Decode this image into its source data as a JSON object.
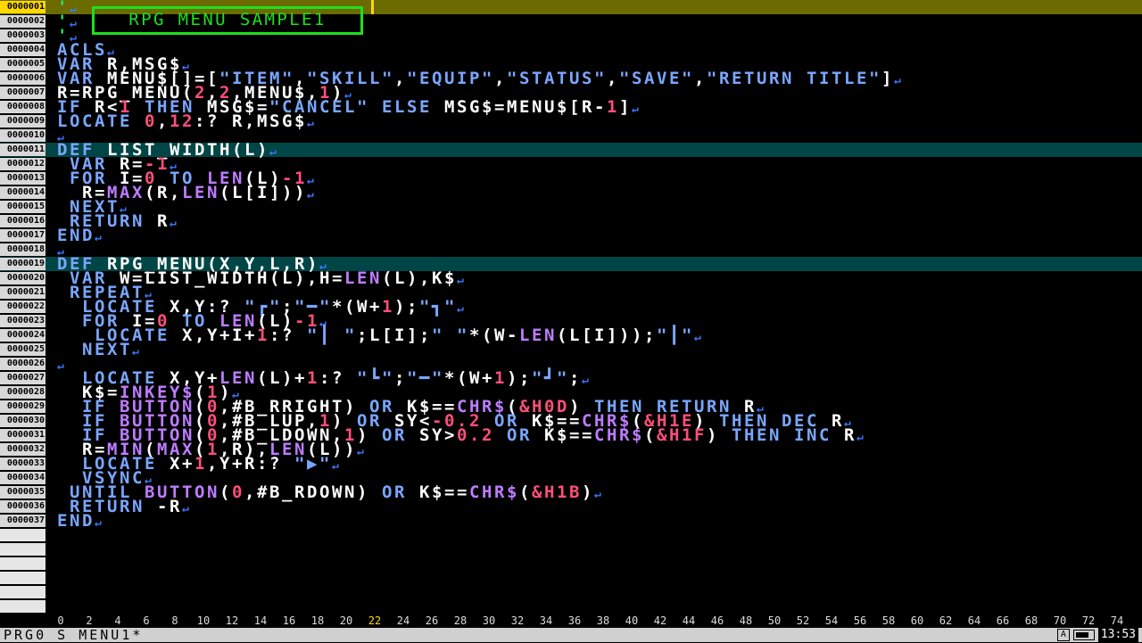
{
  "editor": {
    "current_line": 1,
    "box_comment": "RPG MENU SAMPLE1",
    "lines": [
      {
        "n": "0000001",
        "t": [
          [
            "'",
            "c"
          ]
        ]
      },
      {
        "n": "0000002",
        "t": [
          [
            "'",
            "c"
          ]
        ]
      },
      {
        "n": "0000003",
        "t": [
          [
            "'",
            "c"
          ]
        ]
      },
      {
        "n": "0000004",
        "t": [
          [
            "ACLS",
            "k"
          ]
        ]
      },
      {
        "n": "0000005",
        "t": [
          [
            "VAR",
            "k"
          ],
          [
            " R,MSG$",
            "w"
          ]
        ]
      },
      {
        "n": "0000006",
        "t": [
          [
            "VAR",
            "k"
          ],
          [
            " MENU$[]=[",
            "w"
          ],
          [
            "\"ITEM\"",
            "s"
          ],
          [
            ",",
            "w"
          ],
          [
            "\"SKILL\"",
            "s"
          ],
          [
            ",",
            "w"
          ],
          [
            "\"EQUIP\"",
            "s"
          ],
          [
            ",",
            "w"
          ],
          [
            "\"STATUS\"",
            "s"
          ],
          [
            ",",
            "w"
          ],
          [
            "\"SAVE\"",
            "s"
          ],
          [
            ",",
            "w"
          ],
          [
            "\"RETURN TITLE\"",
            "s"
          ],
          [
            "]",
            "w"
          ]
        ]
      },
      {
        "n": "0000007",
        "t": [
          [
            "R=RPG_MENU(",
            "w"
          ],
          [
            "2",
            "n"
          ],
          [
            ",",
            "w"
          ],
          [
            "2",
            "n"
          ],
          [
            ",MENU$,",
            "w"
          ],
          [
            "1",
            "n"
          ],
          [
            ")",
            "w"
          ]
        ]
      },
      {
        "n": "0000008",
        "t": [
          [
            "IF",
            "k"
          ],
          [
            " R<",
            "w"
          ],
          [
            "1",
            "n"
          ],
          [
            " ",
            "w"
          ],
          [
            "THEN",
            "k"
          ],
          [
            " MSG$=",
            "w"
          ],
          [
            "\"CANCEL\"",
            "s"
          ],
          [
            " ",
            "w"
          ],
          [
            "ELSE",
            "k"
          ],
          [
            " MSG$=MENU$[R-",
            "w"
          ],
          [
            "1",
            "n"
          ],
          [
            "]",
            "w"
          ]
        ]
      },
      {
        "n": "0000009",
        "t": [
          [
            "LOCATE",
            "k"
          ],
          [
            " ",
            "w"
          ],
          [
            "0",
            "n"
          ],
          [
            ",",
            "w"
          ],
          [
            "12",
            "n"
          ],
          [
            ":? R,MSG$",
            "w"
          ]
        ]
      },
      {
        "n": "0000010",
        "t": []
      },
      {
        "n": "0000011",
        "t": [
          [
            "DEF",
            "k"
          ],
          [
            " LIST_WIDTH(L)",
            "w"
          ]
        ],
        "hl": true
      },
      {
        "n": "0000012",
        "t": [
          [
            " ",
            "w"
          ],
          [
            "VAR",
            "k"
          ],
          [
            " R=",
            "w"
          ],
          [
            "-1",
            "n"
          ]
        ]
      },
      {
        "n": "0000013",
        "t": [
          [
            " ",
            "w"
          ],
          [
            "FOR",
            "k"
          ],
          [
            " I=",
            "w"
          ],
          [
            "0",
            "n"
          ],
          [
            " ",
            "w"
          ],
          [
            "TO",
            "k"
          ],
          [
            " ",
            "w"
          ],
          [
            "LEN",
            "f"
          ],
          [
            "(L)",
            "w"
          ],
          [
            "-1",
            "n"
          ]
        ]
      },
      {
        "n": "0000014",
        "t": [
          [
            "  R=",
            "w"
          ],
          [
            "MAX",
            "f"
          ],
          [
            "(R,",
            "w"
          ],
          [
            "LEN",
            "f"
          ],
          [
            "(L[I]))",
            "w"
          ]
        ]
      },
      {
        "n": "0000015",
        "t": [
          [
            " ",
            "w"
          ],
          [
            "NEXT",
            "k"
          ]
        ]
      },
      {
        "n": "0000016",
        "t": [
          [
            " ",
            "w"
          ],
          [
            "RETURN",
            "k"
          ],
          [
            " R",
            "w"
          ]
        ]
      },
      {
        "n": "0000017",
        "t": [
          [
            "END",
            "k"
          ]
        ]
      },
      {
        "n": "0000018",
        "t": []
      },
      {
        "n": "0000019",
        "t": [
          [
            "DEF",
            "k"
          ],
          [
            " RPG_MENU(X,Y,L,R)",
            "w"
          ]
        ],
        "hl": true
      },
      {
        "n": "0000020",
        "t": [
          [
            " ",
            "w"
          ],
          [
            "VAR",
            "k"
          ],
          [
            " W=LIST_WIDTH(L),H=",
            "w"
          ],
          [
            "LEN",
            "f"
          ],
          [
            "(L),K$",
            "w"
          ]
        ]
      },
      {
        "n": "0000021",
        "t": [
          [
            " ",
            "w"
          ],
          [
            "REPEAT",
            "k"
          ]
        ]
      },
      {
        "n": "0000022",
        "t": [
          [
            "  ",
            "w"
          ],
          [
            "LOCATE",
            "k"
          ],
          [
            " X,Y:? ",
            "w"
          ],
          [
            "\"┏\"",
            "s"
          ],
          [
            ";",
            "w"
          ],
          [
            "\"━\"",
            "s"
          ],
          [
            "*(W+",
            "w"
          ],
          [
            "1",
            "n"
          ],
          [
            ");",
            "w"
          ],
          [
            "\"┓\"",
            "s"
          ]
        ]
      },
      {
        "n": "0000023",
        "t": [
          [
            "  ",
            "w"
          ],
          [
            "FOR",
            "k"
          ],
          [
            " I=",
            "w"
          ],
          [
            "0",
            "n"
          ],
          [
            " ",
            "w"
          ],
          [
            "TO",
            "k"
          ],
          [
            " ",
            "w"
          ],
          [
            "LEN",
            "f"
          ],
          [
            "(L)",
            "w"
          ],
          [
            "-1",
            "n"
          ]
        ]
      },
      {
        "n": "0000024",
        "t": [
          [
            "   ",
            "w"
          ],
          [
            "LOCATE",
            "k"
          ],
          [
            " X,Y+I+",
            "w"
          ],
          [
            "1",
            "n"
          ],
          [
            ":? ",
            "w"
          ],
          [
            "\"┃ \"",
            "s"
          ],
          [
            ";L[I];",
            "w"
          ],
          [
            "\" \"",
            "s"
          ],
          [
            "*(W-",
            "w"
          ],
          [
            "LEN",
            "f"
          ],
          [
            "(L[I]));",
            "w"
          ],
          [
            "\"┃\"",
            "s"
          ]
        ]
      },
      {
        "n": "0000025",
        "t": [
          [
            "  ",
            "w"
          ],
          [
            "NEXT",
            "k"
          ]
        ]
      },
      {
        "n": "0000026",
        "t": []
      },
      {
        "n": "0000027",
        "t": [
          [
            "  ",
            "w"
          ],
          [
            "LOCATE",
            "k"
          ],
          [
            " X,Y+",
            "w"
          ],
          [
            "LEN",
            "f"
          ],
          [
            "(L)+",
            "w"
          ],
          [
            "1",
            "n"
          ],
          [
            ":? ",
            "w"
          ],
          [
            "\"┗\"",
            "s"
          ],
          [
            ";",
            "w"
          ],
          [
            "\"━\"",
            "s"
          ],
          [
            "*(W+",
            "w"
          ],
          [
            "1",
            "n"
          ],
          [
            ");",
            "w"
          ],
          [
            "\"┛\"",
            "s"
          ],
          [
            ";",
            "w"
          ]
        ]
      },
      {
        "n": "0000028",
        "t": [
          [
            "  K$=",
            "w"
          ],
          [
            "INKEY$",
            "f"
          ],
          [
            "(",
            "w"
          ],
          [
            "1",
            "n"
          ],
          [
            ")",
            "w"
          ]
        ]
      },
      {
        "n": "0000029",
        "t": [
          [
            "  ",
            "w"
          ],
          [
            "IF",
            "k"
          ],
          [
            " ",
            "w"
          ],
          [
            "BUTTON",
            "f"
          ],
          [
            "(",
            "w"
          ],
          [
            "0",
            "n"
          ],
          [
            ",#B_RRIGHT) ",
            "w"
          ],
          [
            "OR",
            "k"
          ],
          [
            " K$==",
            "w"
          ],
          [
            "CHR$",
            "f"
          ],
          [
            "(",
            "w"
          ],
          [
            "&H0D",
            "n"
          ],
          [
            ") ",
            "w"
          ],
          [
            "THEN",
            "k"
          ],
          [
            " ",
            "w"
          ],
          [
            "RETURN",
            "k"
          ],
          [
            " R",
            "w"
          ]
        ]
      },
      {
        "n": "0000030",
        "t": [
          [
            "  ",
            "w"
          ],
          [
            "IF",
            "k"
          ],
          [
            " ",
            "w"
          ],
          [
            "BUTTON",
            "f"
          ],
          [
            "(",
            "w"
          ],
          [
            "0",
            "n"
          ],
          [
            ",#B_LUP,",
            "w"
          ],
          [
            "1",
            "n"
          ],
          [
            ") ",
            "w"
          ],
          [
            "OR",
            "k"
          ],
          [
            " SY<",
            "w"
          ],
          [
            "-0.2",
            "n"
          ],
          [
            " ",
            "w"
          ],
          [
            "OR",
            "k"
          ],
          [
            " K$==",
            "w"
          ],
          [
            "CHR$",
            "f"
          ],
          [
            "(",
            "w"
          ],
          [
            "&H1E",
            "n"
          ],
          [
            ") ",
            "w"
          ],
          [
            "THEN",
            "k"
          ],
          [
            " ",
            "w"
          ],
          [
            "DEC",
            "k"
          ],
          [
            " R",
            "w"
          ]
        ]
      },
      {
        "n": "0000031",
        "t": [
          [
            "  ",
            "w"
          ],
          [
            "IF",
            "k"
          ],
          [
            " ",
            "w"
          ],
          [
            "BUTTON",
            "f"
          ],
          [
            "(",
            "w"
          ],
          [
            "0",
            "n"
          ],
          [
            ",#B_LDOWN,",
            "w"
          ],
          [
            "1",
            "n"
          ],
          [
            ") ",
            "w"
          ],
          [
            "OR",
            "k"
          ],
          [
            " SY>",
            "w"
          ],
          [
            "0.2",
            "n"
          ],
          [
            " ",
            "w"
          ],
          [
            "OR",
            "k"
          ],
          [
            " K$==",
            "w"
          ],
          [
            "CHR$",
            "f"
          ],
          [
            "(",
            "w"
          ],
          [
            "&H1F",
            "n"
          ],
          [
            ") ",
            "w"
          ],
          [
            "THEN",
            "k"
          ],
          [
            " ",
            "w"
          ],
          [
            "INC",
            "k"
          ],
          [
            " R",
            "w"
          ]
        ]
      },
      {
        "n": "0000032",
        "t": [
          [
            "  R=",
            "w"
          ],
          [
            "MIN",
            "f"
          ],
          [
            "(",
            "w"
          ],
          [
            "MAX",
            "f"
          ],
          [
            "(",
            "w"
          ],
          [
            "1",
            "n"
          ],
          [
            ",R),",
            "w"
          ],
          [
            "LEN",
            "f"
          ],
          [
            "(L))",
            "w"
          ]
        ]
      },
      {
        "n": "0000033",
        "t": [
          [
            "  ",
            "w"
          ],
          [
            "LOCATE",
            "k"
          ],
          [
            " X+",
            "w"
          ],
          [
            "1",
            "n"
          ],
          [
            ",Y+R:? ",
            "w"
          ],
          [
            "\"▶\"",
            "s"
          ]
        ]
      },
      {
        "n": "0000034",
        "t": [
          [
            "  ",
            "w"
          ],
          [
            "VSYNC",
            "k"
          ]
        ]
      },
      {
        "n": "0000035",
        "t": [
          [
            " ",
            "w"
          ],
          [
            "UNTIL",
            "k"
          ],
          [
            " ",
            "w"
          ],
          [
            "BUTTON",
            "f"
          ],
          [
            "(",
            "w"
          ],
          [
            "0",
            "n"
          ],
          [
            ",#B_RDOWN) ",
            "w"
          ],
          [
            "OR",
            "k"
          ],
          [
            " K$==",
            "w"
          ],
          [
            "CHR$",
            "f"
          ],
          [
            "(",
            "w"
          ],
          [
            "&H1B",
            "n"
          ],
          [
            ")",
            "w"
          ]
        ]
      },
      {
        "n": "0000036",
        "t": [
          [
            " ",
            "w"
          ],
          [
            "RETURN",
            "k"
          ],
          [
            " -R",
            "w"
          ]
        ]
      },
      {
        "n": "0000037",
        "t": [
          [
            "END",
            "k"
          ]
        ]
      }
    ],
    "empty_rows": 6
  },
  "ruler": {
    "ticks": [
      "0",
      "2",
      "4",
      "6",
      "8",
      "10",
      "12",
      "14",
      "16",
      "18",
      "20",
      "22",
      "24",
      "26",
      "28",
      "30",
      "32",
      "34",
      "36",
      "38",
      "40",
      "42",
      "44",
      "46",
      "48",
      "50",
      "52",
      "54",
      "56",
      "58",
      "60",
      "62",
      "64",
      "66",
      "68",
      "70",
      "72",
      "74"
    ],
    "current_column": "22"
  },
  "status": {
    "title": "PRG0 S_MENU1*",
    "keyboard_icon": "A",
    "battery_icon": "battery-icon",
    "clock": "13:53"
  },
  "colors": {
    "keyword": "#7aa6ff",
    "number": "#ff4f7a",
    "comment": "#29e06a",
    "function": "#bd7cff",
    "cursor_line": "#6b6b00",
    "def_highlight": "#004646"
  }
}
